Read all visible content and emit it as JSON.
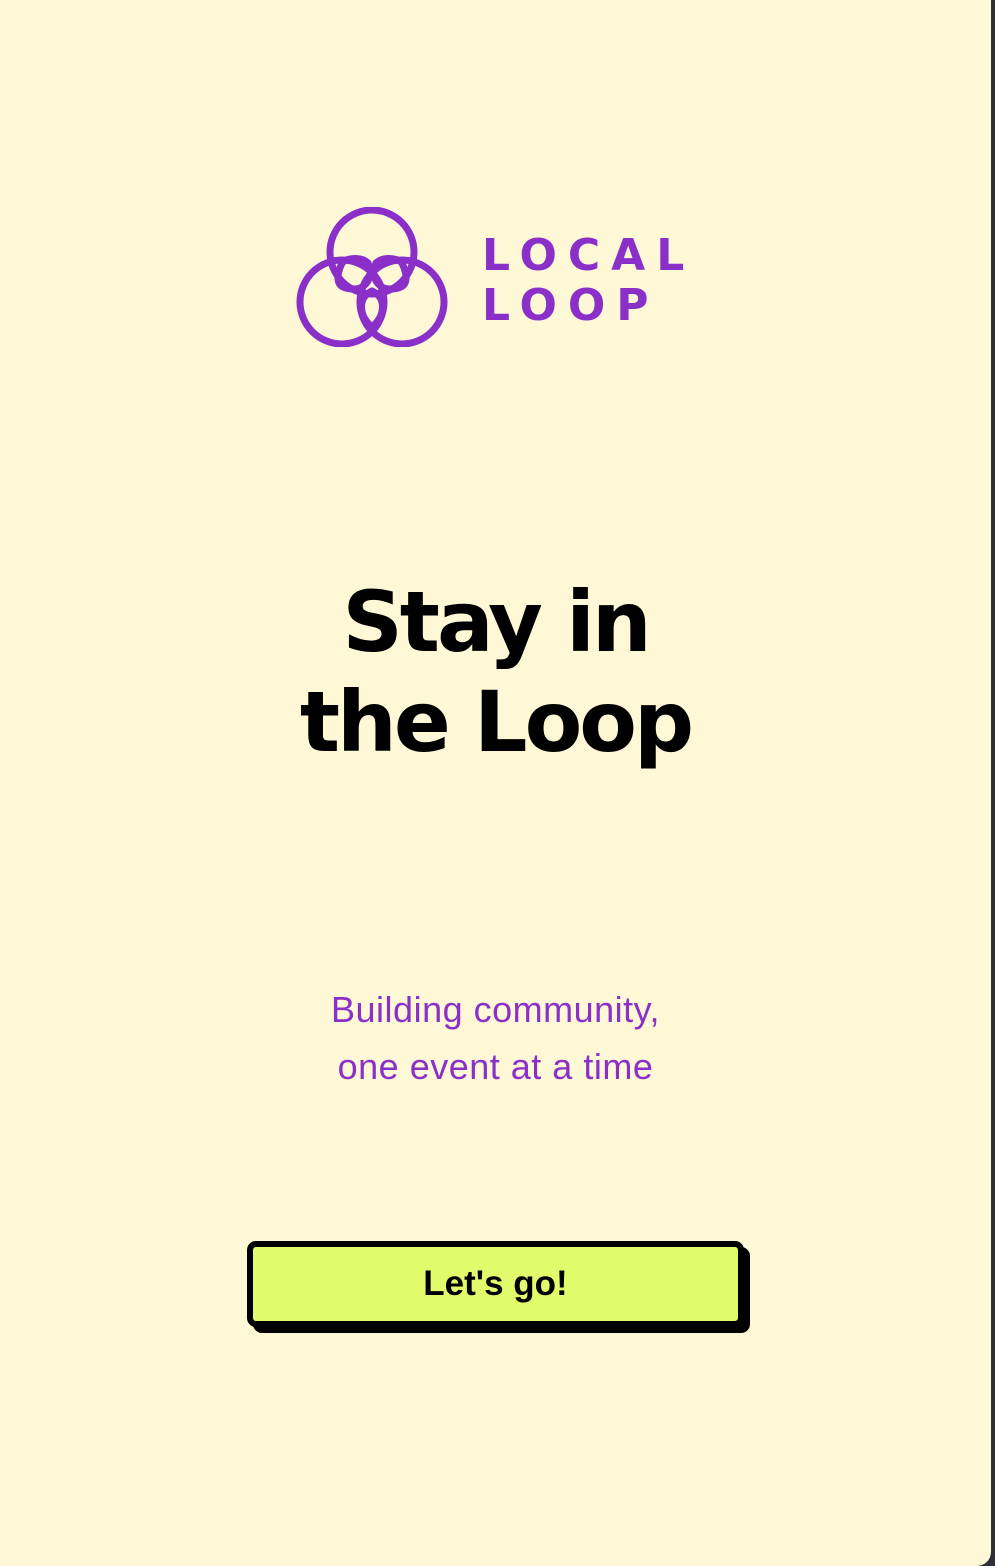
{
  "brand": {
    "logo_icon": "three-loops-icon",
    "name_line1": "LOCAL",
    "name_line2": "LOOP",
    "color": "#8b2fc9"
  },
  "headline": {
    "line1": "Stay in",
    "line2": "the Loop"
  },
  "tagline": {
    "line1": "Building community,",
    "line2": "one event at a time"
  },
  "cta": {
    "label": "Let's go!",
    "background": "#e2fb6b"
  },
  "colors": {
    "background": "#fef8d6",
    "text": "#000000",
    "accent": "#8b2fc9"
  }
}
